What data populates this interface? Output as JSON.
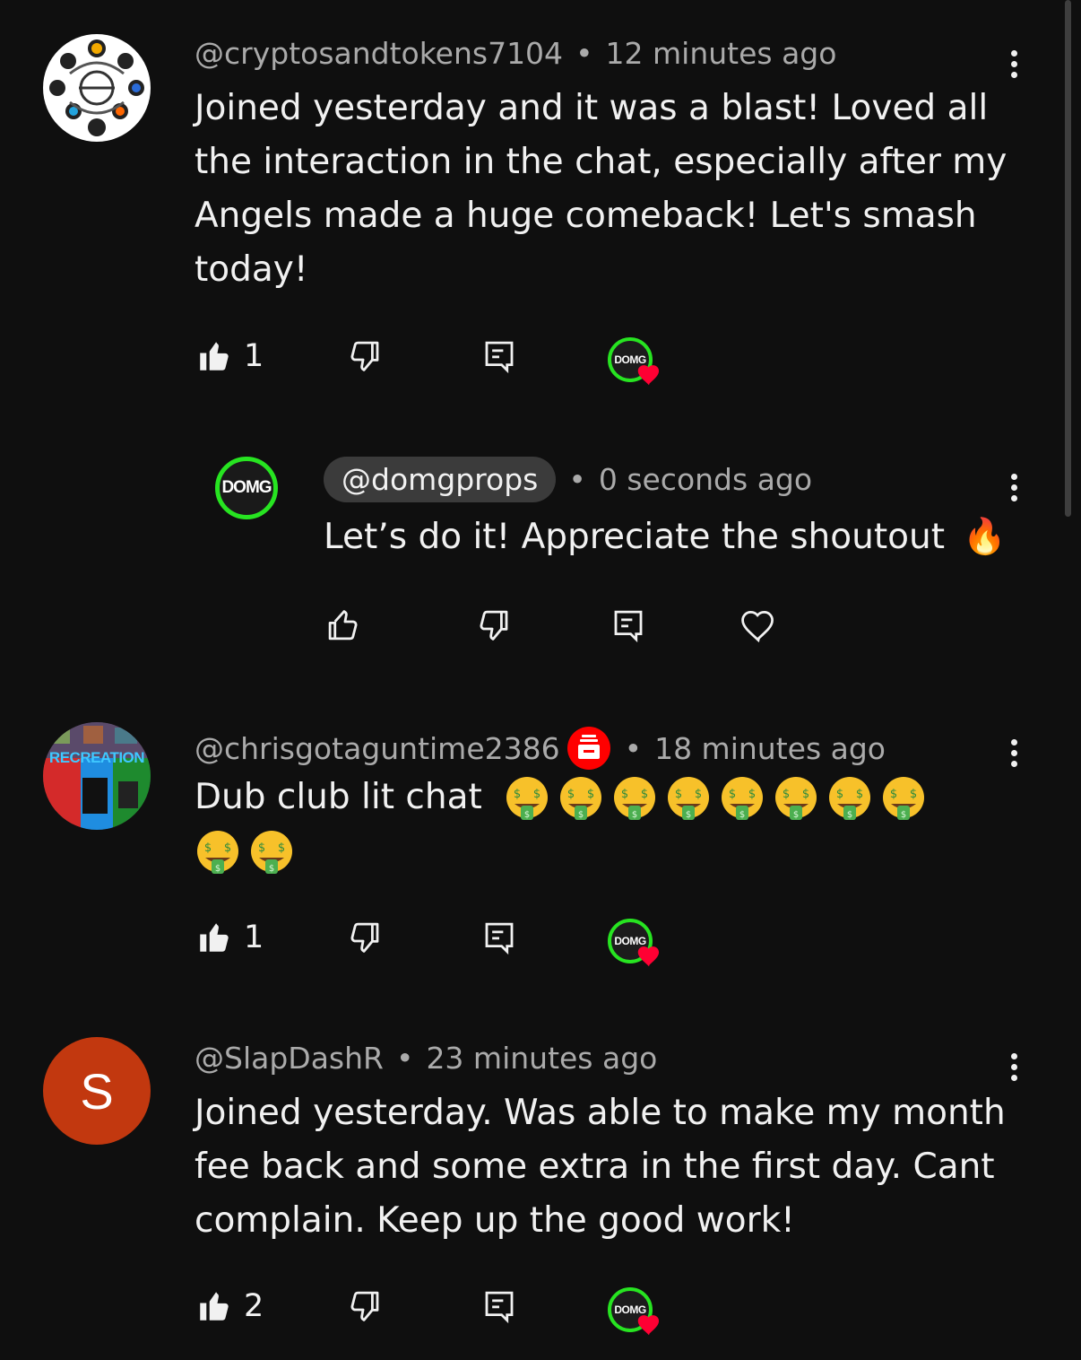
{
  "comments": [
    {
      "handle": "@cryptosandtokens7104",
      "time": "12 minutes ago",
      "text": "Joined yesterday and it was a blast! Loved all the interaction in the chat, especially after my Angels made a huge comeback! Let's smash today!",
      "likes": "1",
      "avatar_icon": "crypto-coins-logo"
    },
    {
      "handle": "@domgprops",
      "time": "0 seconds ago",
      "text": "Let’s do it! Appreciate the shoutout",
      "emoji": "🔥",
      "avatar_text": "DOMG"
    },
    {
      "handle": "@chrisgotaguntime2386",
      "time": "18 minutes ago",
      "text": "Dub club lit chat",
      "emoji": "🤑",
      "emoji_count": 10,
      "likes": "1",
      "avatar_text": "RECREATION"
    },
    {
      "handle": "@SlapDashR",
      "time": "23 minutes ago",
      "text": "Joined yesterday. Was able to make my month fee back and some extra in the first day. Cant complain. Keep up the good work!",
      "likes": "2",
      "avatar_letter": "S"
    }
  ],
  "creator_heart": {
    "label": "DOMG"
  },
  "colors": {
    "background": "#0f0f0f",
    "meta": "#aaaaaa",
    "domg_ring": "#27e421",
    "heart": "#ff0033",
    "slapdash_avatar": "#c2380f"
  }
}
